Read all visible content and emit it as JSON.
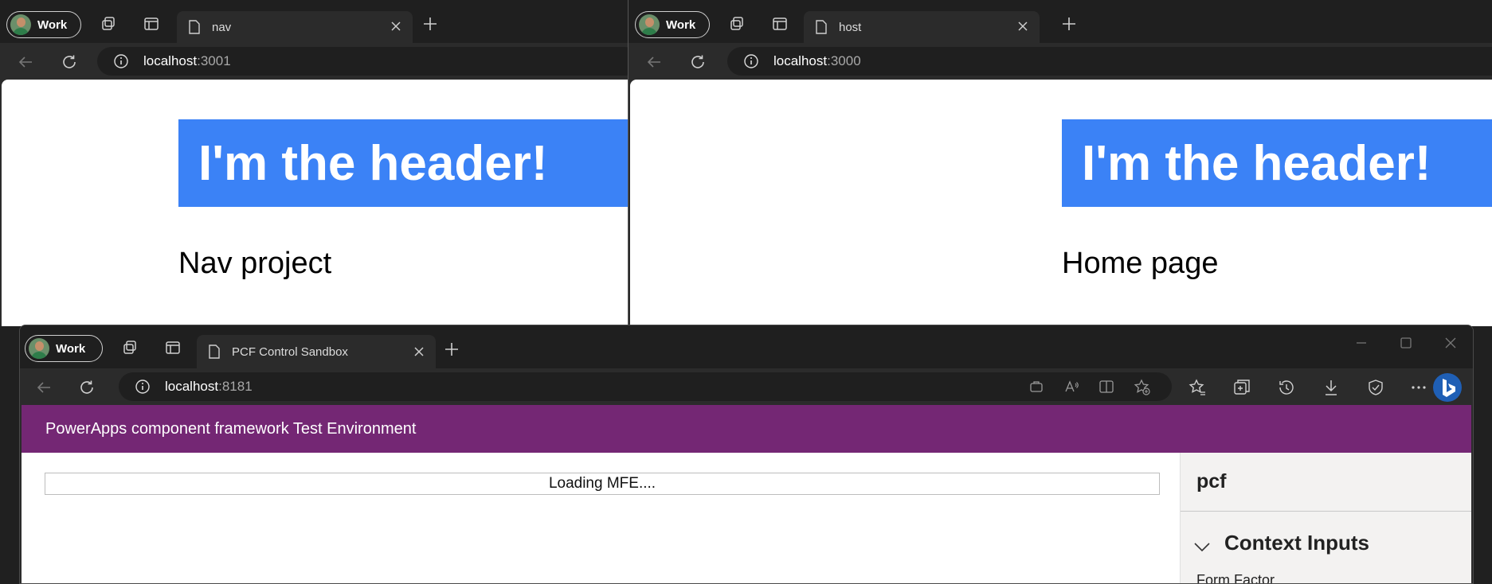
{
  "windows": {
    "nav": {
      "profile_label": "Work",
      "tab_title": "nav",
      "url_host": "localhost",
      "url_port": ":3001",
      "header_text": "I'm the header!",
      "page_text": "Nav project"
    },
    "host": {
      "profile_label": "Work",
      "tab_title": "host",
      "url_host": "localhost",
      "url_port": ":3000",
      "header_text": "I'm the header!",
      "page_text": "Home page"
    },
    "pcf": {
      "profile_label": "Work",
      "tab_title": "PCF Control Sandbox",
      "url_host": "localhost",
      "url_port": ":8181",
      "banner_title": "PowerApps component framework Test Environment",
      "loading_text": "Loading MFE....",
      "side_panel": {
        "title": "pcf",
        "section_label": "Context Inputs",
        "first_field_label": "Form Factor"
      }
    }
  },
  "colors": {
    "header_blue": "#3b82f6",
    "pcf_purple": "#742774",
    "browser_dark": "#1f1f1f",
    "toolbar_dark": "#2b2b2b"
  },
  "icons": {
    "workspaces": "workspaces-icon",
    "tab_actions": "tab-actions-icon",
    "new_tab": "plus-icon",
    "back": "back-arrow-icon",
    "refresh": "refresh-icon",
    "site_info": "info-icon",
    "close_tab": "close-icon",
    "bing": "bing-copilot-icon"
  }
}
